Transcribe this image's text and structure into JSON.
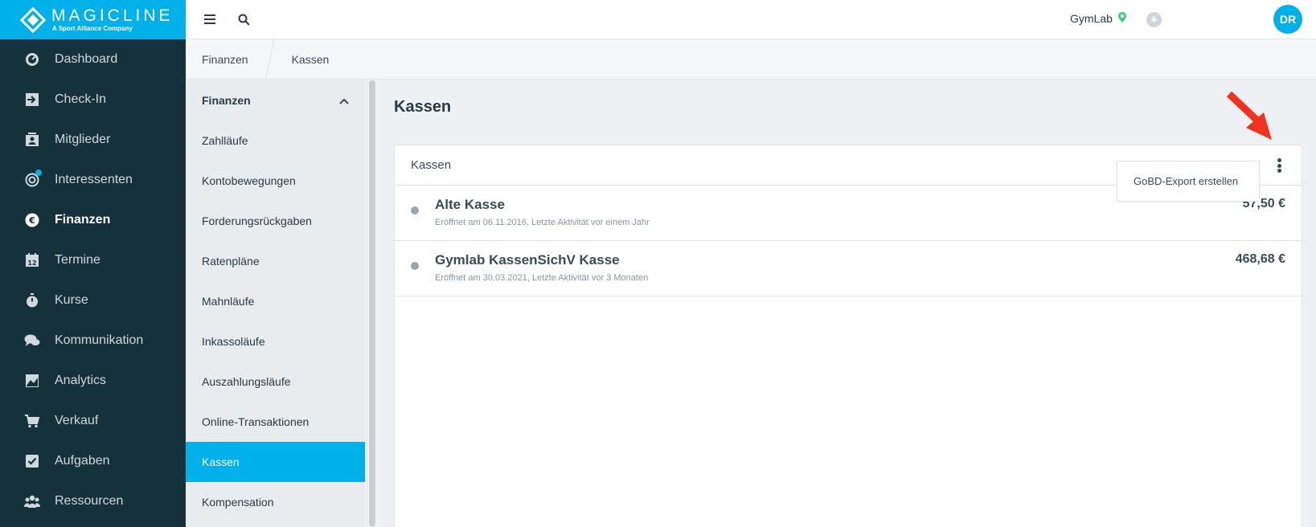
{
  "brand": {
    "name": "MAGICLINE",
    "tagline": "A Sport Alliance Company"
  },
  "nav": {
    "items": [
      {
        "label": "Dashboard",
        "icon": "dashboard-icon"
      },
      {
        "label": "Check-In",
        "icon": "check-in-icon"
      },
      {
        "label": "Mitglieder",
        "icon": "members-icon"
      },
      {
        "label": "Interessenten",
        "icon": "leads-icon"
      },
      {
        "label": "Finanzen",
        "icon": "euro-icon",
        "active": true
      },
      {
        "label": "Termine",
        "icon": "calendar-icon"
      },
      {
        "label": "Kurse",
        "icon": "stopwatch-icon"
      },
      {
        "label": "Kommunikation",
        "icon": "chat-icon"
      },
      {
        "label": "Analytics",
        "icon": "chart-icon"
      },
      {
        "label": "Verkauf",
        "icon": "cart-icon"
      },
      {
        "label": "Aufgaben",
        "icon": "checkbox-icon"
      },
      {
        "label": "Ressourcen",
        "icon": "people-icon"
      }
    ],
    "calendar_day": "12"
  },
  "topbar": {
    "studio": "GymLab",
    "avatar_initials": "DR"
  },
  "breadcrumb": [
    "Finanzen",
    "Kassen"
  ],
  "subnav": {
    "header": "Finanzen",
    "items": [
      "Zahlläufe",
      "Kontobewegungen",
      "Forderungsrückgaben",
      "Ratenpläne",
      "Mahnläufe",
      "Inkassoläufe",
      "Auszahlungsläufe",
      "Online-Transaktionen",
      "Kassen",
      "Kompensation"
    ],
    "active": "Kassen"
  },
  "main": {
    "title": "Kassen",
    "card_title": "Kassen",
    "menu_item": "GoBD-Export erstellen",
    "rows": [
      {
        "name": "Alte Kasse",
        "sub": "Eröffnet am 06.11.2016, Letzte Aktivität vor einem Jahr",
        "amount": "57,50 €"
      },
      {
        "name": "Gymlab KassenSichV Kasse",
        "sub": "Eröffnet am 30.03.2021, Letzte Aktivität vor 3 Monaten",
        "amount": "468,68 €"
      }
    ]
  },
  "colors": {
    "accent": "#00b0e8",
    "nav_bg": "#14313c",
    "arrow": "#f0321e",
    "pin": "#3ccf86"
  }
}
